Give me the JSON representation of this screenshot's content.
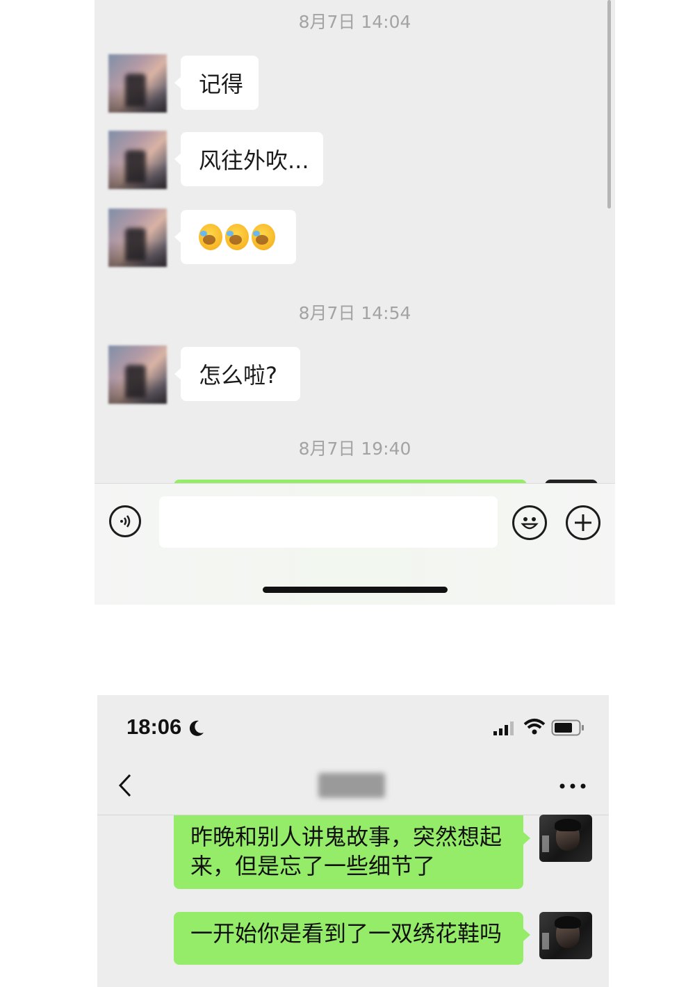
{
  "chat_top": {
    "timestamps": [
      "8月7日 14:04",
      "8月7日 14:54",
      "8月7日 19:40"
    ],
    "messages": [
      {
        "text": "记得"
      },
      {
        "text": "风往外吹..."
      },
      {
        "text": "",
        "emoji": [
          "face-with-tears-of-joy",
          "face-with-tears-of-joy",
          "face-with-tears-of-joy"
        ]
      },
      {
        "text": "怎么啦?"
      }
    ],
    "input": {
      "value": "",
      "placeholder": ""
    },
    "icons": {
      "voice": "voice-icon",
      "emoji": "emoji-icon",
      "more": "plus-icon"
    }
  },
  "chat_bottom": {
    "status_bar": {
      "time": "18:06",
      "icons": [
        "moon-icon",
        "signal-icon",
        "wifi-icon",
        "battery-icon"
      ]
    },
    "nav": {
      "back_icon": "chevron-left-icon",
      "contact_name": "",
      "more_icon": "ellipsis-icon"
    },
    "messages": [
      {
        "text": "昨晚和别人讲鬼故事，突然想起来，但是忘了一些细节了"
      },
      {
        "text": "一开始你是看到了一双绣花鞋吗"
      }
    ]
  },
  "colors": {
    "chat_bg": "#ededed",
    "bubble_in": "#ffffff",
    "bubble_out": "#95ec69",
    "timestamp": "#a3a3a3"
  }
}
